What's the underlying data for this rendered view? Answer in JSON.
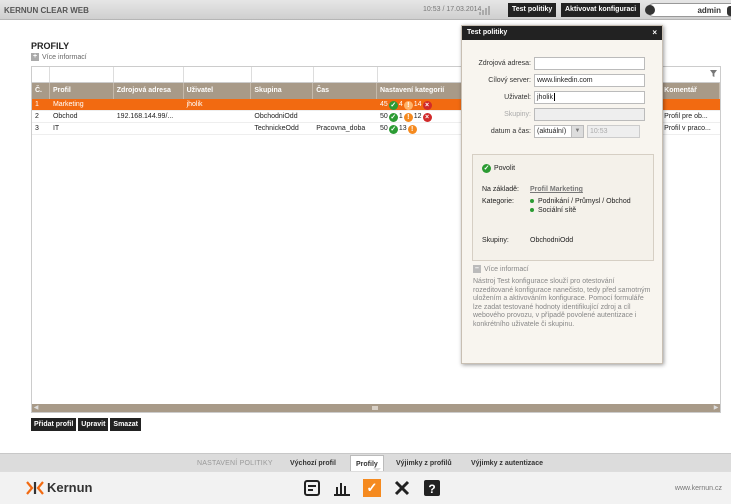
{
  "app": {
    "title": "KERNUN CLEAR WEB",
    "clock": "10:53 / 17.03.2014",
    "test_btn": "Test politiky",
    "activate_btn": "Aktivovat konfiguraci",
    "user": "admin"
  },
  "page": {
    "title": "PROFILY",
    "more_info": "Více informací"
  },
  "table": {
    "headers": [
      "Č.",
      "Profil",
      "Zdrojová adresa",
      "Uživatel",
      "Skupina",
      "Čas",
      "Nastavení kategorií",
      "Komentář"
    ],
    "rows": [
      {
        "n": "1",
        "profil": "Marketing",
        "addr": "",
        "user": "jholik",
        "group": "",
        "time": "",
        "ok": "45",
        "warn": "4",
        "warn_n": "14",
        "comment": ""
      },
      {
        "n": "2",
        "profil": "Obchod",
        "addr": "192.168.144.99/...",
        "user": "",
        "group": "ObchodniOdd",
        "time": "",
        "ok": "50",
        "warn": "1",
        "warn_n": "12",
        "comment": "Profil pre ob..."
      },
      {
        "n": "3",
        "profil": "IT",
        "addr": "",
        "user": "",
        "group": "TechnickeOdd",
        "time": "Pracovna_doba",
        "ok": "50",
        "warn": "13",
        "warn_n": "",
        "comment": "Profil v praco..."
      }
    ]
  },
  "actions": {
    "add": "Přidat profil",
    "edit": "Upravit",
    "delete": "Smazat"
  },
  "subnav": {
    "label": "NASTAVENÍ POLITIKY",
    "tabs": [
      "Výchozí profil",
      "Profily",
      "Výjimky z profilů",
      "Výjimky z autentizace"
    ],
    "active": "Profily"
  },
  "footer": {
    "brand": "Kernun",
    "url": "www.kernun.cz"
  },
  "dialog": {
    "title": "Test politiky",
    "close": "×",
    "fields": {
      "src_label": "Zdrojová adresa:",
      "src_value": "",
      "server_label": "Cílový server:",
      "server_value": "www.linkedin.com",
      "user_label": "Uživatel:",
      "user_value": "jholik",
      "groups_label": "Skupiny:",
      "groups_value": "",
      "datetime_label": "datum a čas:",
      "datetime_select": "(aktuální)",
      "time_value": "10:53"
    },
    "result": {
      "status": "Povolit",
      "basis_label": "Na základě:",
      "basis_value": "Profil Marketing",
      "categories_label": "Kategorie:",
      "categories": [
        "Podnikání / Průmysl / Obchod",
        "Sociální sítě"
      ],
      "groups_label": "Skupiny:",
      "groups_value": "ObchodniOdd"
    },
    "more_info": "Více informací",
    "description": "Nástroj Test konfigurace slouží pro otestování rozeditované konfigurace nanečisto, tedy před samotným uložením a aktivováním konfigurace. Pomocí formuláře lze zadat testované hodnoty identifikující zdroj a cíl webového provozu, v případě povolené autentizace i konkrétního uživatele či skupinu."
  },
  "colors": {
    "accent": "#f26a11",
    "header_bg": "#a89a88",
    "ok": "#2b9b33",
    "warn": "#f58a1f",
    "deny": "#d12a2a"
  }
}
